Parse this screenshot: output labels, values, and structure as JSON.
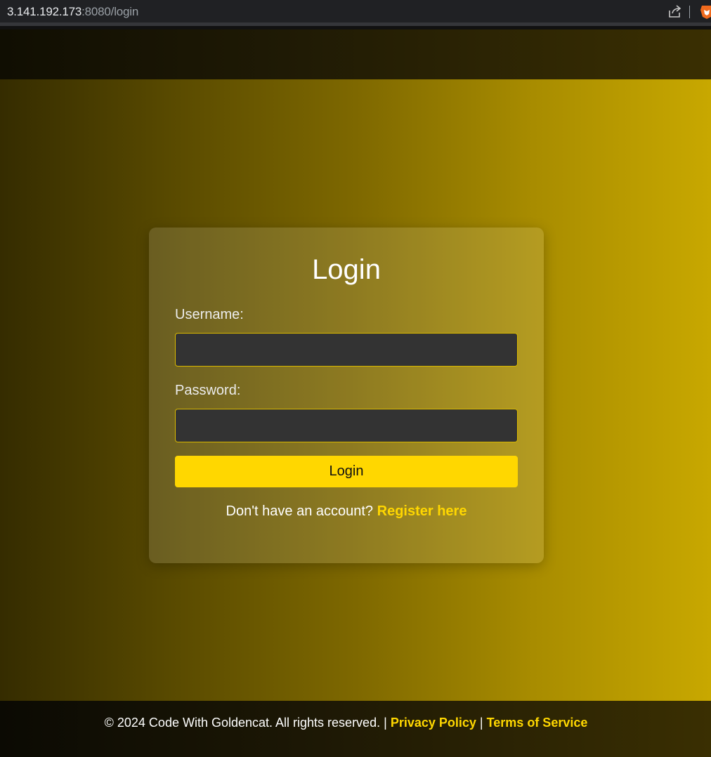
{
  "browser": {
    "url_host": "3.141.192.173",
    "url_path": ":8080/login"
  },
  "login": {
    "title": "Login",
    "username_label": "Username:",
    "username_value": "",
    "password_label": "Password:",
    "password_value": "",
    "submit_label": "Login",
    "register_prompt": "Don't have an account?",
    "register_link": "Register here"
  },
  "footer": {
    "copyright": "© 2024 Code With Goldencat. All rights reserved.",
    "separator": "|",
    "privacy_link": "Privacy Policy",
    "terms_link": "Terms of Service"
  },
  "colors": {
    "accent": "#ffd700",
    "input_bg": "#333333",
    "browser_bar": "#202124"
  },
  "icons": [
    "share-icon",
    "brave-lion-icon"
  ]
}
